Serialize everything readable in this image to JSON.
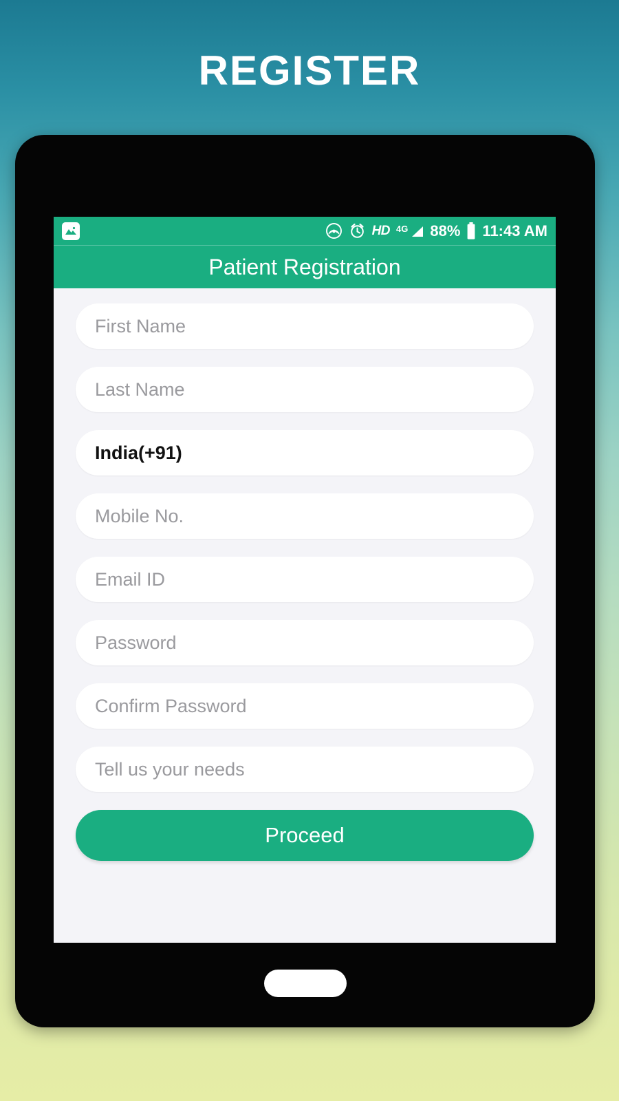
{
  "page": {
    "title": "REGISTER"
  },
  "device": {
    "home_button_name": "home-button"
  },
  "status_bar": {
    "notification_icon": "image-gallery-icon",
    "hotspot_icon": "hotspot-icon",
    "alarm_icon": "alarm-clock-icon",
    "hd_label": "HD",
    "network_label": "4G",
    "signal_icon": "signal-bars-icon",
    "battery_percent": "88%",
    "battery_icon": "battery-icon",
    "time": "11:43 AM"
  },
  "app_bar": {
    "title": "Patient Registration"
  },
  "form": {
    "fields": [
      {
        "name": "first-name",
        "value": "First Name",
        "filled": false
      },
      {
        "name": "last-name",
        "value": "Last Name",
        "filled": false
      },
      {
        "name": "country-code",
        "value": "India(+91)",
        "filled": true
      },
      {
        "name": "mobile-number",
        "value": "Mobile No.",
        "filled": false
      },
      {
        "name": "email-id",
        "value": "Email ID",
        "filled": false
      },
      {
        "name": "password",
        "value": "Password",
        "filled": false
      },
      {
        "name": "confirm-password",
        "value": "Confirm Password",
        "filled": false
      },
      {
        "name": "needs",
        "value": "Tell us your needs",
        "filled": false
      }
    ],
    "submit_label": "Proceed"
  },
  "colors": {
    "accent_green": "#1aae81",
    "form_background": "#f4f4f8",
    "field_background": "#ffffff",
    "placeholder_text": "#9a9a9e",
    "filled_text": "#111111",
    "bezel": "#050505"
  }
}
